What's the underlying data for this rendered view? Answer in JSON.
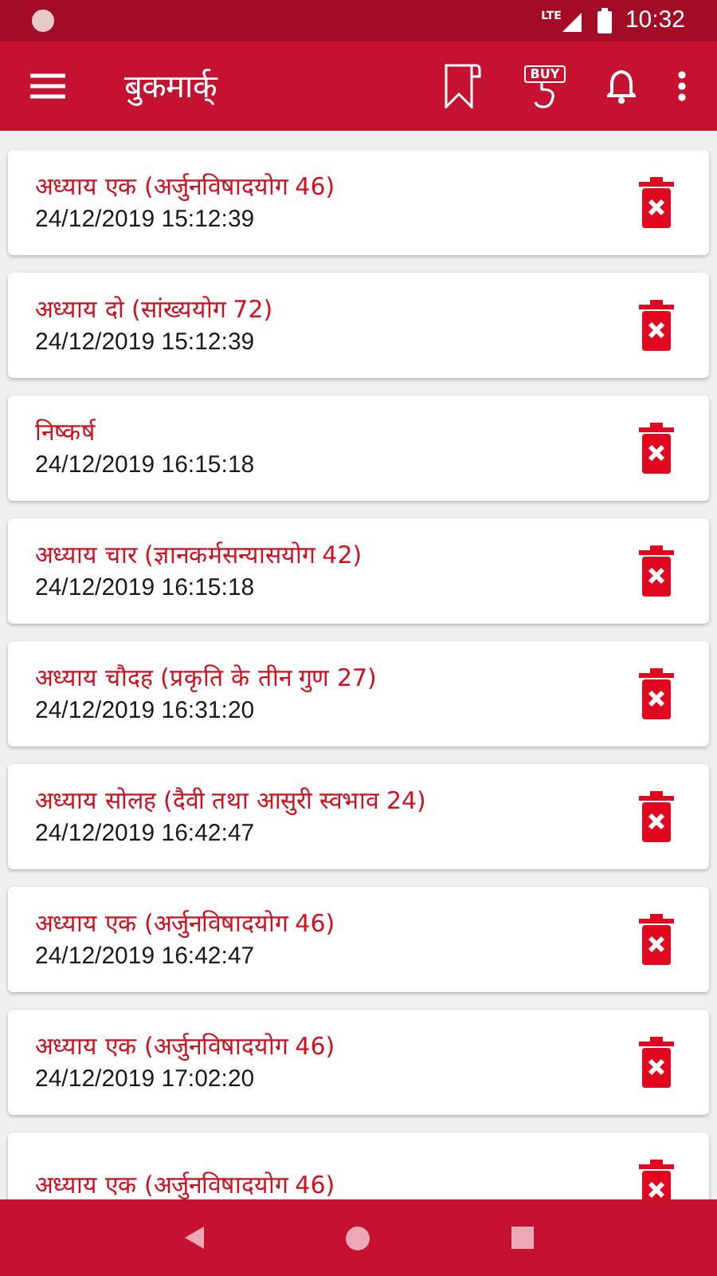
{
  "status_bar": {
    "network": "LTE",
    "time": "10:32"
  },
  "app_bar": {
    "title": "बुकमार्क्",
    "buy_label": "BUY"
  },
  "bookmarks": [
    {
      "title": "अध्याय एक (अर्जुनविषादयोग 46)",
      "date": "24/12/2019 15:12:39"
    },
    {
      "title": "अध्याय दो (सांख्ययोग 72)",
      "date": "24/12/2019 15:12:39"
    },
    {
      "title": "निष्कर्ष",
      "date": "24/12/2019 16:15:18"
    },
    {
      "title": "अध्याय चार (ज्ञानकर्मसन्यासयोग 42)",
      "date": "24/12/2019 16:15:18"
    },
    {
      "title": "अध्याय चौदह (प्रकृति के तीन गुण 27)",
      "date": "24/12/2019 16:31:20"
    },
    {
      "title": "अध्याय सोलह (दैवी तथा आसुरी स्वभाव 24)",
      "date": "24/12/2019 16:42:47"
    },
    {
      "title": "अध्याय एक (अर्जुनविषादयोग 46)",
      "date": "24/12/2019 16:42:47"
    },
    {
      "title": "अध्याय एक (अर्जुनविषादयोग 46)",
      "date": "24/12/2019 17:02:20"
    },
    {
      "title": "अध्याय एक (अर्जुनविषादयोग 46)"
    }
  ]
}
